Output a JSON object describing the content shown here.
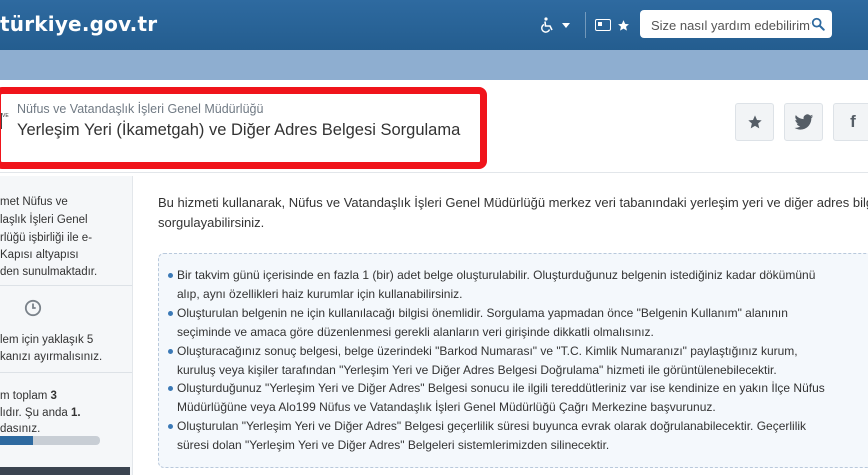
{
  "topbar": {
    "logo": "türkiye.gov.tr",
    "search_placeholder": "Size nasıl yardım edebilirim?",
    "colors": {
      "bar": "#2a6496",
      "band": "#8eaed0",
      "highlight": "#f0141b"
    }
  },
  "header": {
    "agency": "Nüfus ve Vatandaşlık İşleri Genel Müdürlüğü",
    "title": "Yerleşim Yeri (İkametgah) ve Diğer Adres Belgesi Sorgulama",
    "service_icon_text": "VE"
  },
  "share": {
    "icons": [
      "star-icon",
      "twitter-icon",
      "facebook-icon"
    ],
    "facebook_glyph": "f"
  },
  "sidebar": {
    "about_lines": [
      "met Nüfus ve",
      "laşlık İşleri Genel",
      "rlüğü işbirliği ile e-",
      "Kapısı altyapısı",
      "den sunulmaktadır."
    ],
    "time_lines": [
      "lem için yaklaşık 5",
      "kanızı ayırmalısınız."
    ],
    "step_lines": [
      "m toplam 3",
      "lıdır. Şu anda 1.",
      "dasınız."
    ],
    "total_steps": "3",
    "current_step": "1.",
    "progress_fraction": 0.33
  },
  "content": {
    "intro_lines": [
      "Bu hizmeti kullanarak, Nüfus ve Vatandaşlık İşleri Genel Müdürlüğü merkez veri tabanındaki yerleşim yeri ve diğer adres bilgileri",
      "sorgulayabilirsiniz."
    ],
    "info_items": [
      [
        "Bir takvim günü içerisinde en fazla 1 (bir) adet belge oluşturulabilir. Oluşturduğunuz belgenin istediğiniz kadar dökümünü",
        "alıp, aynı özellikleri haiz kurumlar için kullanabilirsiniz."
      ],
      [
        "Oluşturulan belgenin ne için kullanılacağı bilgisi önemlidir. Sorgulama yapmadan önce \"Belgenin Kullanım\" alanının",
        "seçiminde ve amaca göre düzenlenmesi gerekli alanların veri girişinde dikkatli olmalısınız."
      ],
      [
        "Oluşturacağınız sonuç belgesi, belge üzerindeki \"Barkod Numarası\" ve \"T.C. Kimlik Numaranızı\" paylaştığınız kurum,",
        "kuruluş veya kişiler tarafından \"Yerleşim Yeri ve Diğer Adres Belgesi Doğrulama\" hizmeti ile görüntülenebilecektir."
      ],
      [
        "Oluşturduğunuz \"Yerleşim Yeri ve Diğer Adres\" Belgesi sonucu ile ilgili tereddütleriniz var ise kendinize en yakın İlçe Nüfus",
        "Müdürlüğüne veya Alo199 Nüfus ve Vatandaşlık İşleri Genel Müdürlüğü Çağrı Merkezine başvurunuz."
      ],
      [
        "Oluşturulan \"Yerleşim Yeri ve Diğer Adres\" Belgesi geçerlilik süresi buyunca evrak olarak doğrulanabilecektir. Geçerlilik",
        "süresi dolan \"Yerleşim Yeri ve Diğer Adres\" Belgeleri sistemlerimizden silinecektir."
      ]
    ]
  }
}
